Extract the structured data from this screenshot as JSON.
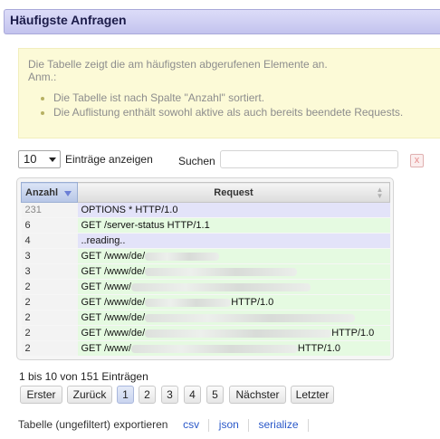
{
  "header": {
    "title": "Häufigste Anfragen"
  },
  "info": {
    "line1": "Die Tabelle zeigt die am häufigsten abgerufenen Elemente an.",
    "line2": "Anm.:",
    "notes": [
      "Die Tabelle ist nach Spalte \"Anzahl\" sortiert.",
      "Die Auflistung enthält sowohl aktive als auch bereits beendete Requests."
    ]
  },
  "controls": {
    "page_length": "10",
    "length_label": "Einträge anzeigen",
    "search_label": "Suchen",
    "search_value": "",
    "clear_label": "x"
  },
  "table": {
    "columns": [
      "Anzahl",
      "Request"
    ],
    "rows": [
      {
        "count": "231",
        "request": "OPTIONS * HTTP/1.0",
        "suffix": ""
      },
      {
        "count": "6",
        "request": "GET /server-status HTTP/1.1",
        "suffix": ""
      },
      {
        "count": "4",
        "request": "..reading..",
        "suffix": ""
      },
      {
        "count": "3",
        "request": "GET /www/de/",
        "suffix": ""
      },
      {
        "count": "3",
        "request": "GET /www/de/",
        "suffix": ""
      },
      {
        "count": "2",
        "request": "GET /www/",
        "suffix": ""
      },
      {
        "count": "2",
        "request": "GET /www/de/",
        "suffix": "HTTP/1.0"
      },
      {
        "count": "2",
        "request": "GET /www/de/",
        "suffix": ""
      },
      {
        "count": "2",
        "request": "GET /www/de/",
        "suffix": "HTTP/1.0"
      },
      {
        "count": "2",
        "request": "GET /www/",
        "suffix": "HTTP/1.0"
      }
    ]
  },
  "pager": {
    "info": "1 bis 10 von 151 Einträgen",
    "first": "Erster",
    "prev": "Zurück",
    "pages": [
      "1",
      "2",
      "3",
      "4",
      "5"
    ],
    "next": "Nächster",
    "last": "Letzter"
  },
  "export": {
    "label": "Tabelle (ungefiltert) exportieren",
    "links": [
      "csv",
      "json",
      "serialize"
    ]
  },
  "colors": {
    "header_bg": "#c8c8f0",
    "info_bg": "#fcfad7",
    "row_green": "#e5fae1",
    "row_blue": "#e3e3f9",
    "link": "#2a58c9"
  }
}
